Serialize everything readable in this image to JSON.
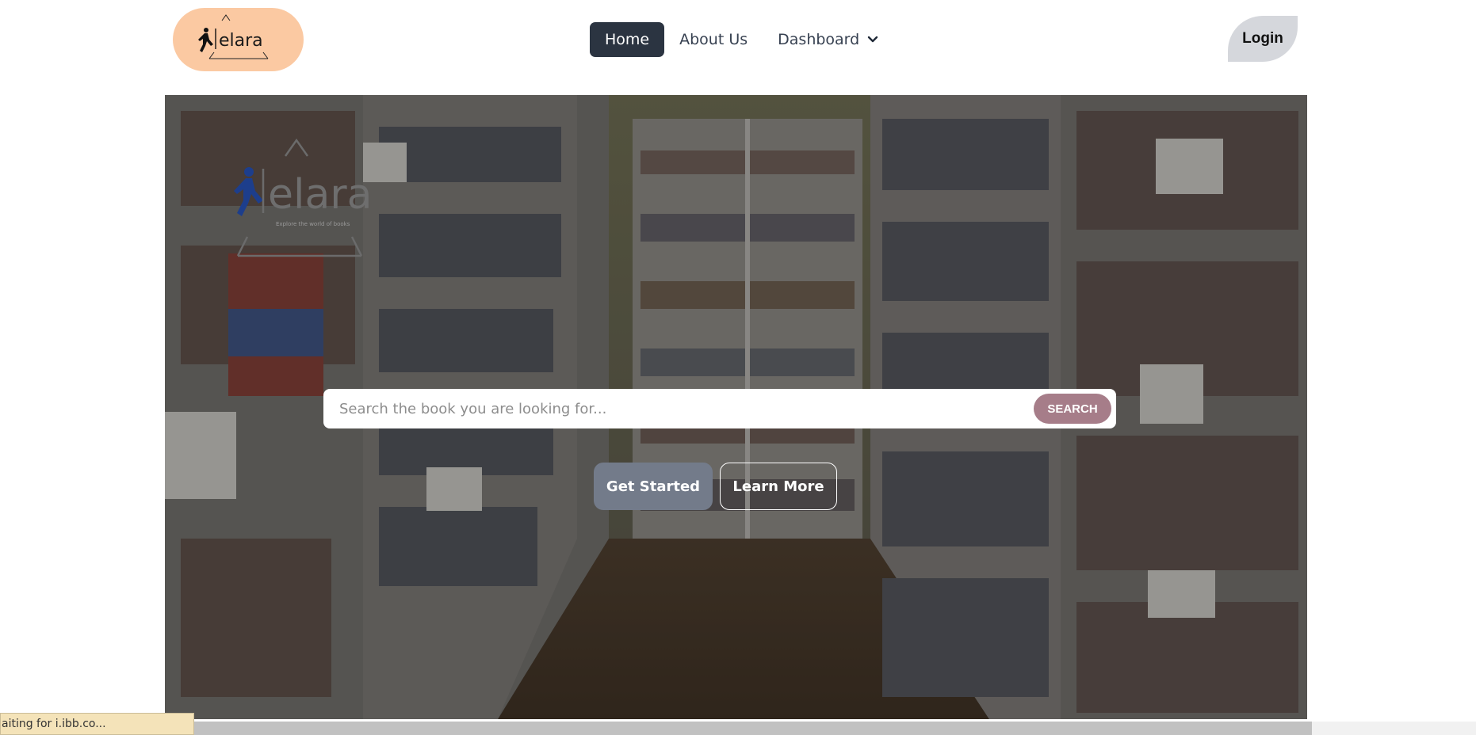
{
  "navbar": {
    "brand": "elara",
    "links": [
      {
        "label": "Home",
        "active": true
      },
      {
        "label": "About Us",
        "active": false
      },
      {
        "label": "Dashboard",
        "active": false,
        "has_dropdown": true
      }
    ],
    "login_label": "Login"
  },
  "hero": {
    "brand": "elara",
    "tagline": "Explore the world of books",
    "search": {
      "placeholder": "Search the book you are looking for...",
      "value": "",
      "button_label": "SEARCH"
    },
    "primary_button": "Get Started",
    "secondary_button": "Learn More"
  },
  "status_bar": {
    "text": "aiting for i.ibb.co..."
  },
  "colors": {
    "logo_pill": "#fbc9a2",
    "active_nav": "#2b3441",
    "login_bg": "#d5d7dc",
    "search_button": "#a67d89",
    "get_started": "#737b8a"
  },
  "icons": [
    "chevron-down-icon",
    "walking-man-icon",
    "triangle-icon"
  ]
}
